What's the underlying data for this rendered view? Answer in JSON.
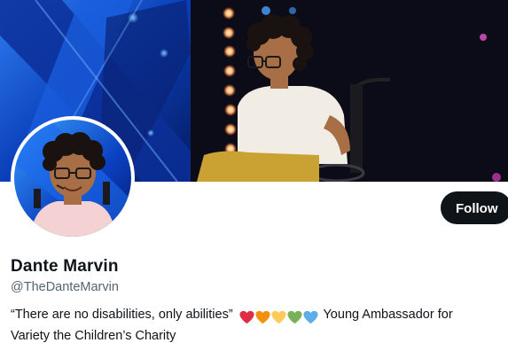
{
  "profile": {
    "display_name": "Dante Marvin",
    "handle": "@TheDanteMarvin",
    "follow_label": "Follow",
    "bio_quote": "“There are no disabilities, only abilities”",
    "bio_line1_tail": "Young Ambassador for",
    "bio_line2": "Variety the Children’s Charity",
    "bio_hearts": [
      {
        "name": "red-heart-icon",
        "color": "#dd2e44"
      },
      {
        "name": "orange-heart-icon",
        "color": "#f4900c"
      },
      {
        "name": "yellow-heart-icon",
        "color": "#fdcb58"
      },
      {
        "name": "green-heart-icon",
        "color": "#78b159"
      },
      {
        "name": "blue-heart-icon",
        "color": "#5dadec"
      }
    ]
  },
  "colors": {
    "button_bg": "#0f1419",
    "text_primary": "#0f1419",
    "text_secondary": "#536471"
  }
}
